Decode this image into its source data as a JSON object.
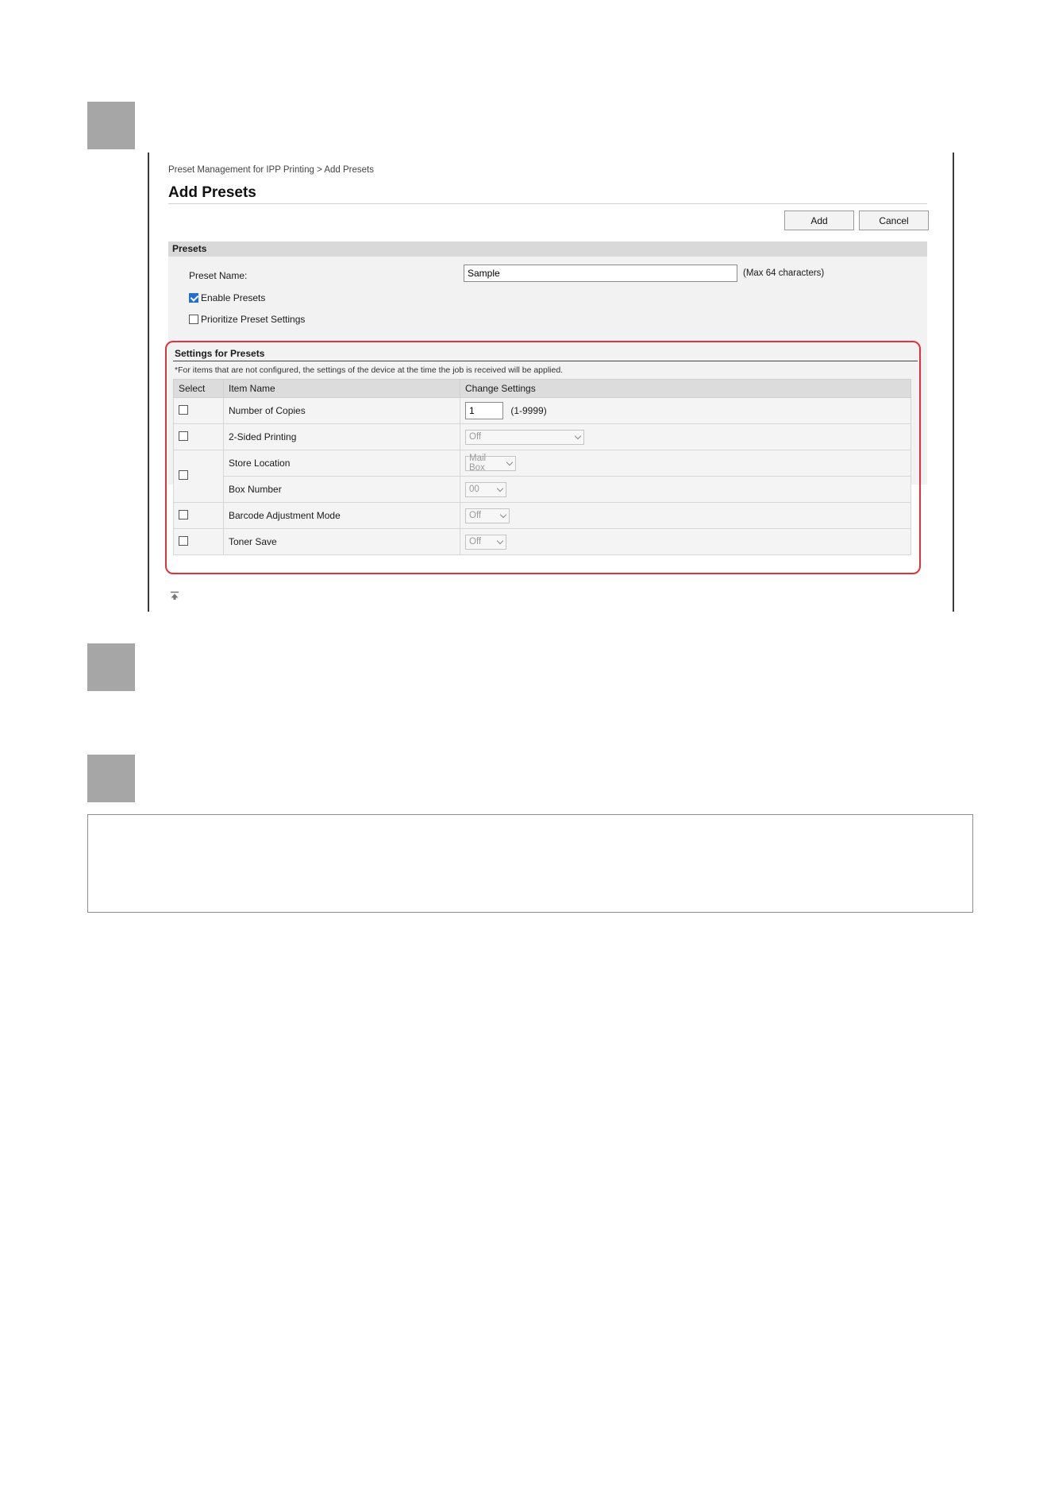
{
  "breadcrumb": "Preset Management for IPP Printing > Add Presets",
  "page_title": "Add Presets",
  "buttons": {
    "add": "Add",
    "cancel": "Cancel"
  },
  "presets": {
    "header": "Presets",
    "preset_name_label": "Preset Name:",
    "preset_name_value": "Sample",
    "max_note": "(Max 64 characters)",
    "enable_label": "Enable Presets",
    "enable_checked": true,
    "prioritize_label": "Prioritize Preset Settings",
    "prioritize_checked": false
  },
  "settings": {
    "title": "Settings for Presets",
    "note": "*For items that are not configured, the settings of the device at the time the job is received will be applied.",
    "columns": [
      "Select",
      "Item Name",
      "Change Settings"
    ],
    "rows": [
      {
        "item": "Number of Copies",
        "value": "1",
        "range": "(1-9999)"
      },
      {
        "item": "2-Sided Printing",
        "value": "Off"
      },
      {
        "item": "Store Location",
        "value": "Mail Box"
      },
      {
        "item": "Box Number",
        "value": "00"
      },
      {
        "item": "Barcode Adjustment Mode",
        "value": "Off"
      },
      {
        "item": "Toner Save",
        "value": "Off"
      }
    ]
  },
  "colors": {
    "highlight": "#e0323c",
    "checkbox_checked": "#1f6fd6",
    "step_box": "#a6a6a6"
  }
}
